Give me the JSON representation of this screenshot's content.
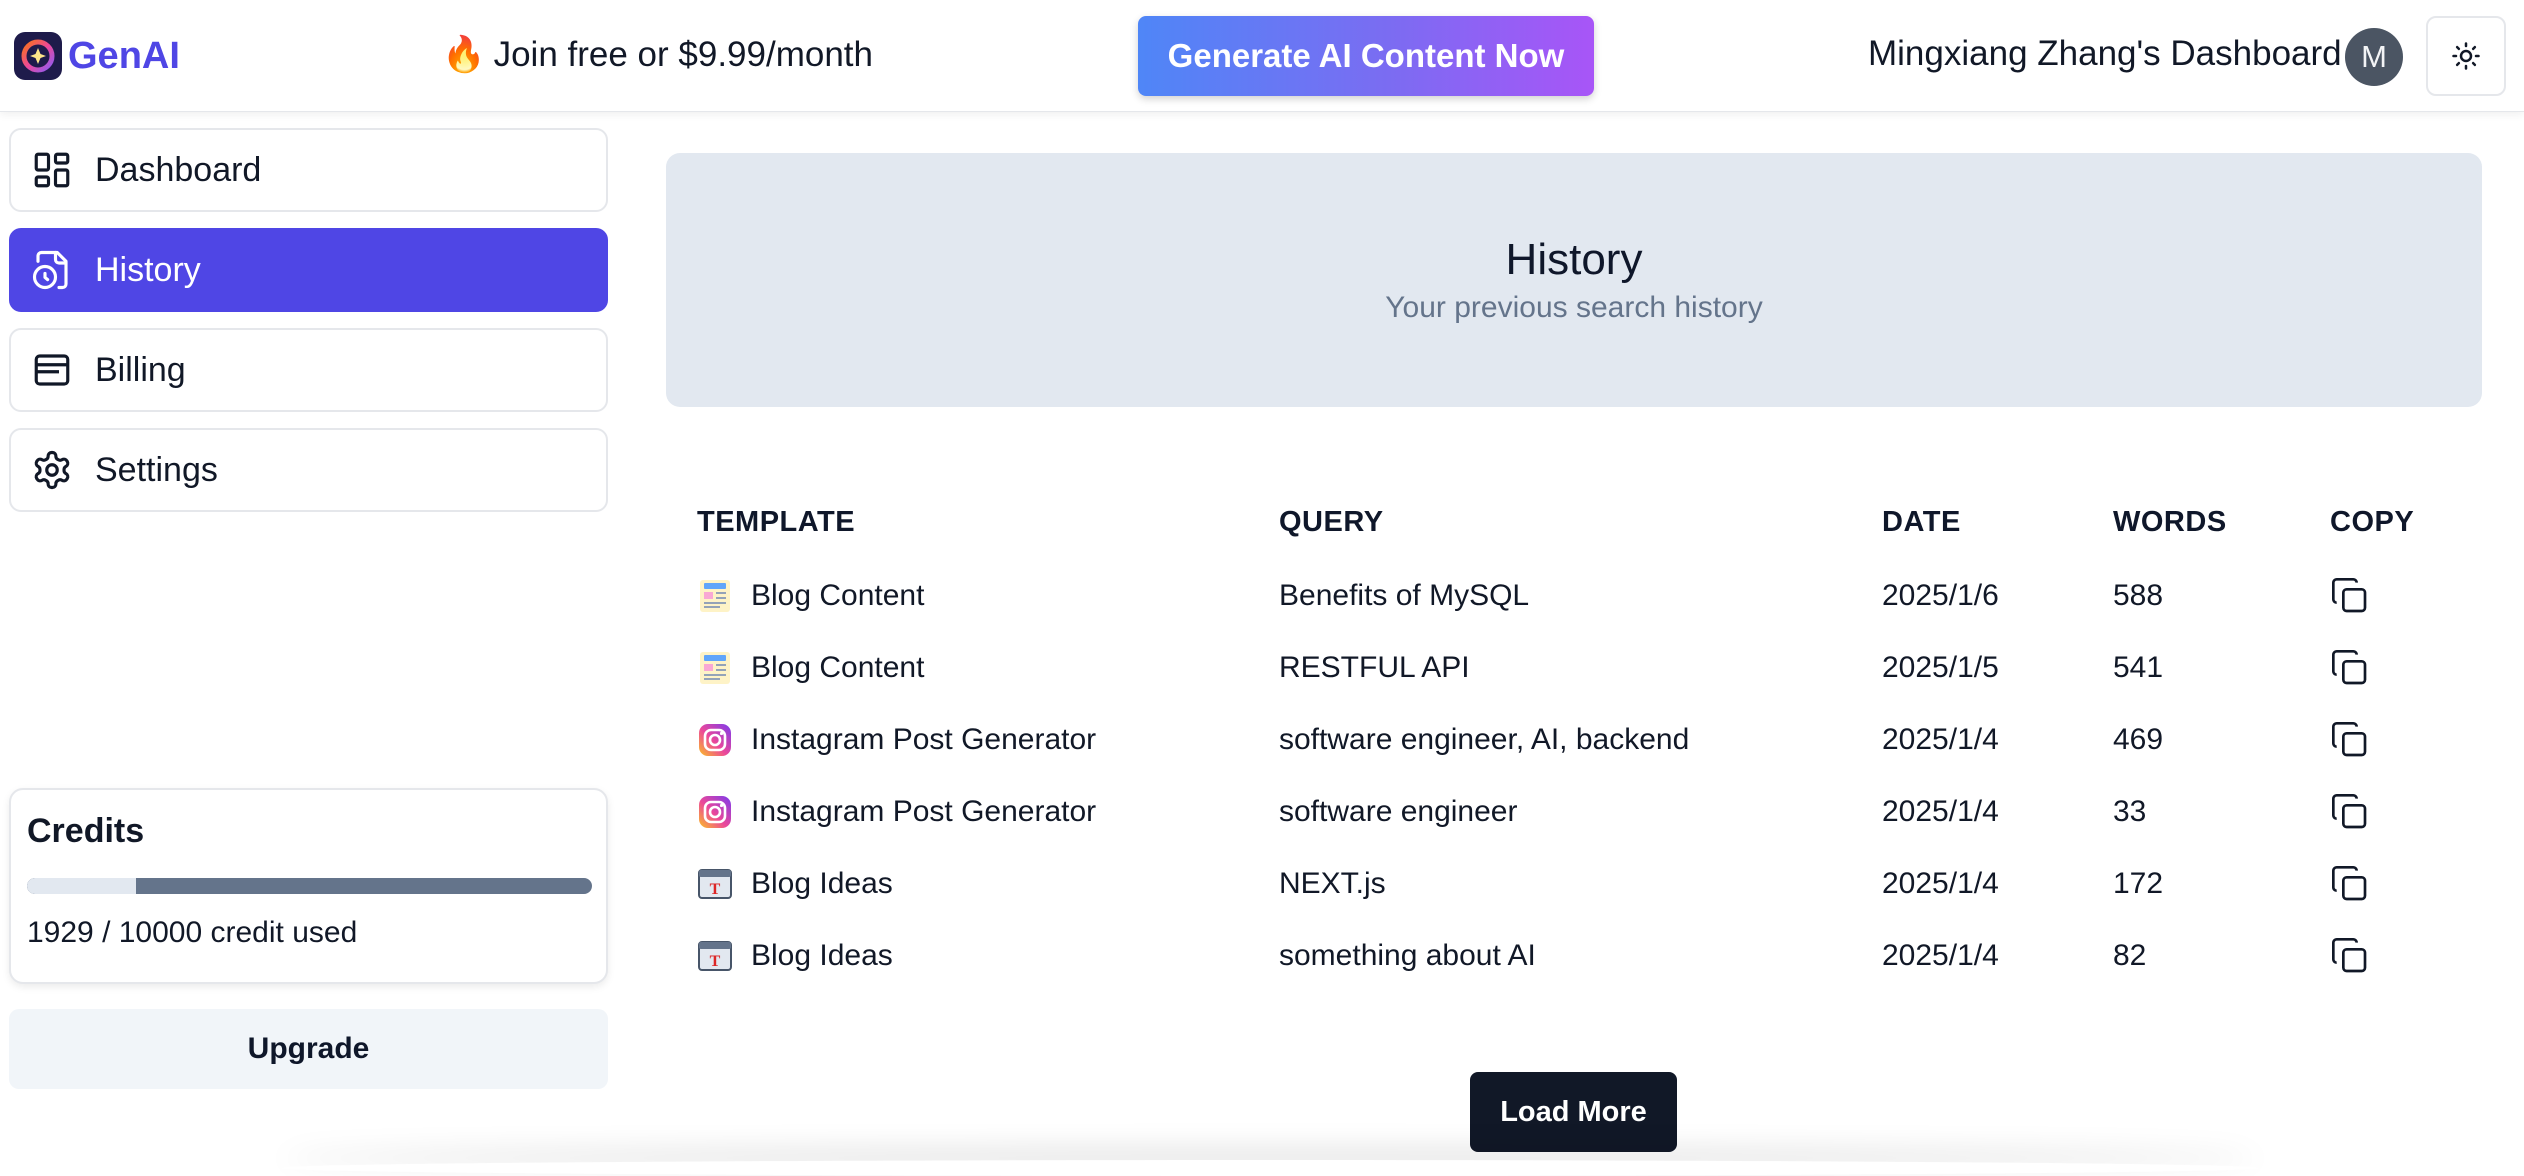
{
  "brand": {
    "name": "GenAI"
  },
  "header": {
    "promo_emoji": "🔥",
    "promo_text": "Join free or $9.99/month",
    "cta_label": "Generate AI Content Now",
    "dashboard_title": "Mingxiang Zhang's Dashboard",
    "avatar_initial": "M",
    "theme_icon": "sun-icon"
  },
  "sidebar": {
    "items": [
      {
        "label": "Dashboard",
        "icon": "dashboard-grid-icon",
        "active": false
      },
      {
        "label": "History",
        "icon": "file-clock-icon",
        "active": true
      },
      {
        "label": "Billing",
        "icon": "wallet-icon",
        "active": false
      },
      {
        "label": "Settings",
        "icon": "gear-icon",
        "active": false
      }
    ],
    "credits": {
      "title": "Credits",
      "used": 1929,
      "total": 10000,
      "text": "1929 / 10000 credit used"
    },
    "upgrade_label": "Upgrade"
  },
  "main": {
    "title": "History",
    "subtitle": "Your previous search history",
    "columns": [
      "TEMPLATE",
      "QUERY",
      "DATE",
      "WORDS",
      "COPY"
    ],
    "rows": [
      {
        "template": "Blog Content",
        "icon": "blog-content-icon",
        "query": "Benefits of MySQL",
        "date": "2025/1/6",
        "words": "588"
      },
      {
        "template": "Blog Content",
        "icon": "blog-content-icon",
        "query": "RESTFUL API",
        "date": "2025/1/5",
        "words": "541"
      },
      {
        "template": "Instagram Post Generator",
        "icon": "instagram-icon",
        "query": "software engineer, AI, backend",
        "date": "2025/1/4",
        "words": "469"
      },
      {
        "template": "Instagram Post Generator",
        "icon": "instagram-icon",
        "query": "software engineer",
        "date": "2025/1/4",
        "words": "33"
      },
      {
        "template": "Blog Ideas",
        "icon": "blog-ideas-icon",
        "query": "NEXT.js",
        "date": "2025/1/4",
        "words": "172"
      },
      {
        "template": "Blog Ideas",
        "icon": "blog-ideas-icon",
        "query": "something about AI",
        "date": "2025/1/4",
        "words": "82"
      }
    ],
    "load_more_label": "Load More"
  },
  "colors": {
    "brand": "#4f46e5",
    "cta_gradient_start": "#4f86f7",
    "cta_gradient_end": "#a855f7",
    "banner_bg": "#e2e8f0",
    "dark_button": "#111827"
  }
}
